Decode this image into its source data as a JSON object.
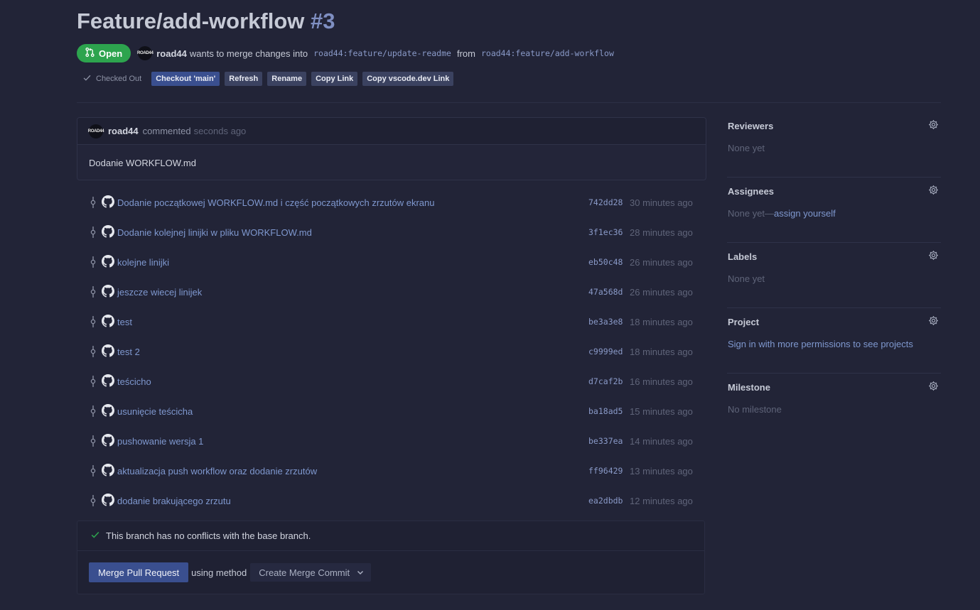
{
  "pr": {
    "title": "Feature/add-workflow",
    "number": "#3",
    "state": "Open",
    "author": "road44",
    "avatar_text": "ROAD44",
    "merge_text": "wants to merge changes into",
    "base_branch": "road44:feature/update-readme",
    "from_text": "from",
    "head_branch": "road44:feature/add-workflow"
  },
  "actions": {
    "checked_out": "Checked Out",
    "checkout_main": "Checkout 'main'",
    "refresh": "Refresh",
    "rename": "Rename",
    "copy_link": "Copy Link",
    "copy_vscode": "Copy vscode.dev Link"
  },
  "comment": {
    "author": "road44",
    "verb": "commented",
    "time": "seconds ago",
    "body": "Dodanie WORKFLOW.md"
  },
  "commits": [
    {
      "message": "Dodanie początkowej WORKFLOW.md i część początkowych zrzutów ekranu",
      "sha": "742dd28",
      "time": "30 minutes ago"
    },
    {
      "message": "Dodanie kolejnej linijki w pliku WORKFLOW.md",
      "sha": "3f1ec36",
      "time": "28 minutes ago"
    },
    {
      "message": "kolejne linijki",
      "sha": "eb50c48",
      "time": "26 minutes ago"
    },
    {
      "message": "jeszcze wiecej linijek",
      "sha": "47a568d",
      "time": "26 minutes ago"
    },
    {
      "message": "test",
      "sha": "be3a3e8",
      "time": "18 minutes ago"
    },
    {
      "message": "test 2",
      "sha": "c9999ed",
      "time": "18 minutes ago"
    },
    {
      "message": "teścicho",
      "sha": "d7caf2b",
      "time": "16 minutes ago"
    },
    {
      "message": "usunięcie teścicha",
      "sha": "ba18ad5",
      "time": "15 minutes ago"
    },
    {
      "message": "pushowanie wersja 1",
      "sha": "be337ea",
      "time": "14 minutes ago"
    },
    {
      "message": "aktualizacja push workflow oraz dodanie zrzutów",
      "sha": "ff96429",
      "time": "13 minutes ago"
    },
    {
      "message": "dodanie brakującego zrzutu",
      "sha": "ea2dbdb",
      "time": "12 minutes ago"
    }
  ],
  "merge": {
    "status": "This branch has no conflicts with the base branch.",
    "button": "Merge Pull Request",
    "using": "using method",
    "method": "Create Merge Commit"
  },
  "sidebar": {
    "reviewers": {
      "title": "Reviewers",
      "value": "None yet"
    },
    "assignees": {
      "title": "Assignees",
      "value": "None yet—",
      "link": "assign yourself"
    },
    "labels": {
      "title": "Labels",
      "value": "None yet"
    },
    "project": {
      "title": "Project",
      "link": "Sign in with more permissions to see projects"
    },
    "milestone": {
      "title": "Milestone",
      "value": "No milestone"
    }
  },
  "colors": {
    "background": "#222437",
    "open_badge": "#2da44e",
    "link": "#7f98cf",
    "primary_button": "#3a4f8f"
  }
}
